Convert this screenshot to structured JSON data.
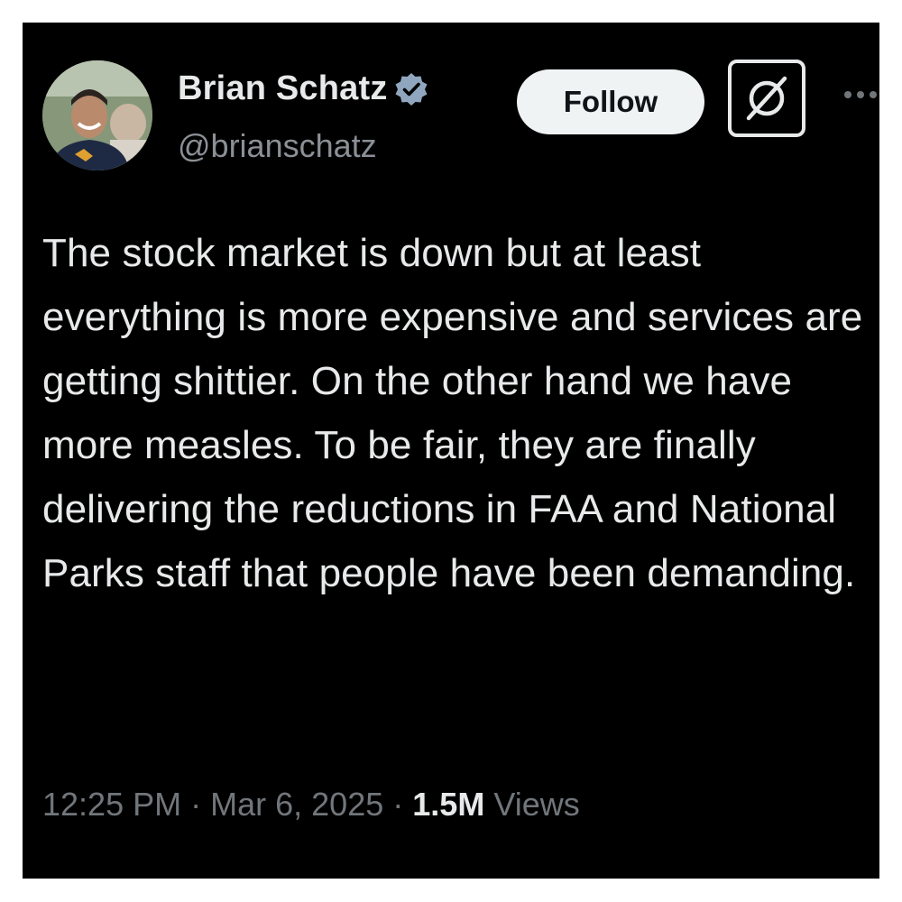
{
  "author": {
    "name": "Brian Schatz",
    "handle": "@brianschatz",
    "verified": true,
    "avatar_icon": "profile-photo"
  },
  "actions": {
    "follow_label": "Follow",
    "grok_icon": "grok-icon",
    "more_icon": "more-icon"
  },
  "tweet": {
    "text": "The stock market is down but at least everything is more expensive and services are getting shittier. On the other hand we have more measles. To be fair, they are finally delivering the reductions in FAA and National Parks staff that people have been demanding."
  },
  "meta": {
    "time": "12:25 PM",
    "separator": "·",
    "date": "Mar 6, 2025",
    "views_count": "1.5M",
    "views_label": "Views"
  },
  "colors": {
    "background": "#000000",
    "text_primary": "#e7e9ea",
    "text_secondary": "#71767b",
    "verified_badge": "#8fa6be"
  }
}
